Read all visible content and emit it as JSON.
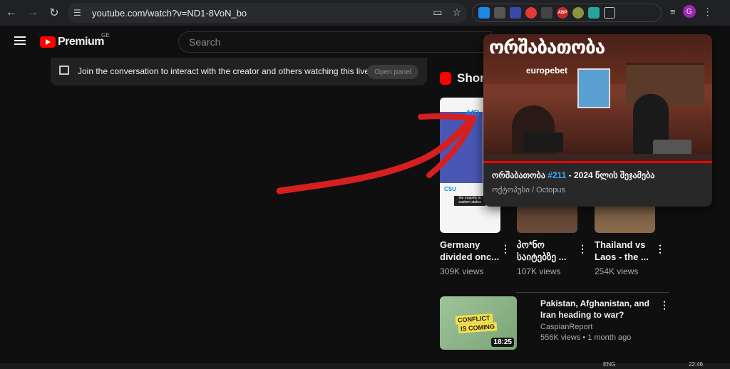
{
  "browser": {
    "url": "youtube.com/watch?v=ND1-8VoN_bo",
    "profile_initial": "G",
    "extensions": [
      "ABP"
    ]
  },
  "header": {
    "logo_text": "Premium",
    "country_code": "GE",
    "search_placeholder": "Search"
  },
  "chat": {
    "message": "Join the conversation to interact with the creator and others watching this live s...",
    "open_panel_label": "Open panel"
  },
  "shorts": {
    "title": "Shorts",
    "items": [
      {
        "title": "Germany\ndivided onc...",
        "views": "309K views"
      },
      {
        "title": "პო*ნო\nსაიტებზე ...",
        "views": "107K views"
      },
      {
        "title": "Thailand vs\nLaos - the ...",
        "views": "254K views"
      }
    ]
  },
  "popup": {
    "title_prefix": "ორშაბათობა ",
    "title_hash": "#211",
    "title_suffix": " - 2024 წლის შეჯამება",
    "channel": "ოქტოპუსი / Octopus",
    "thumb_brand": "europebet",
    "progress": 1.0
  },
  "recommended": {
    "title": "Pakistan, Afghanistan, and Iran heading to war?",
    "channel": "CaspianReport",
    "meta": "556K views • 1 month ago",
    "duration": "18:25",
    "thumb_text_1": "CONFLICT",
    "thumb_text_2": "IS COMING"
  },
  "taskbar": {
    "lang": "ENG",
    "time": "22:46"
  },
  "colors": {
    "accent_red": "#ff0000",
    "link_blue": "#3ea6ff",
    "annotation_arrow": "#d61f1f"
  }
}
